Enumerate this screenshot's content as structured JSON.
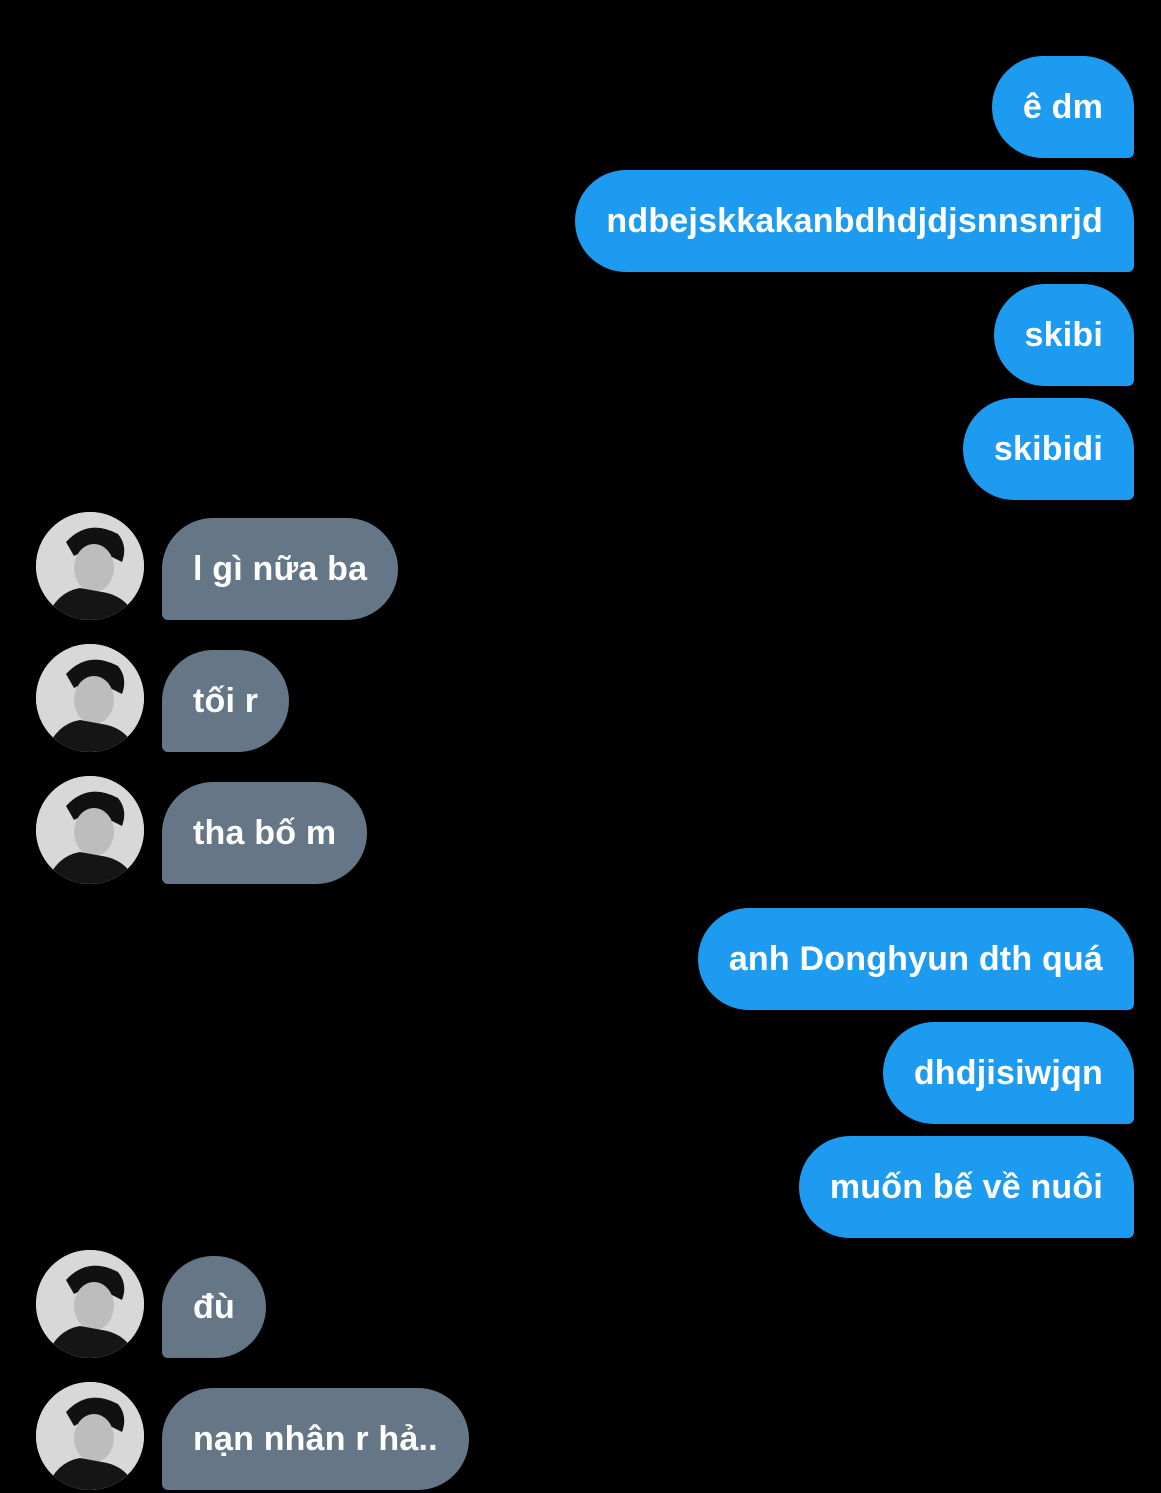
{
  "colors": {
    "background": "#000000",
    "outgoing_bubble": "#1d9bf0",
    "incoming_bubble": "#657786",
    "text": "#ffffff"
  },
  "messages": [
    {
      "direction": "outgoing",
      "text": "ê dm"
    },
    {
      "direction": "outgoing",
      "text": "ndbejskkakanbdhdjdjsnnsnrjd"
    },
    {
      "direction": "outgoing",
      "text": "skibi"
    },
    {
      "direction": "outgoing",
      "text": "skibidi"
    },
    {
      "direction": "incoming",
      "text": "l gì nữa ba",
      "avatar_icon": "user-avatar-icon"
    },
    {
      "direction": "incoming",
      "text": "tối r",
      "avatar_icon": "user-avatar-icon"
    },
    {
      "direction": "incoming",
      "text": "tha bố m",
      "avatar_icon": "user-avatar-icon"
    },
    {
      "direction": "outgoing",
      "text": "anh Donghyun dth quá"
    },
    {
      "direction": "outgoing",
      "text": "dhdjisiwjqn"
    },
    {
      "direction": "outgoing",
      "text": "muốn bế về nuôi"
    },
    {
      "direction": "incoming",
      "text": "đù",
      "avatar_icon": "user-avatar-icon"
    },
    {
      "direction": "incoming",
      "text": "nạn nhân r hả..",
      "avatar_icon": "user-avatar-icon"
    }
  ]
}
